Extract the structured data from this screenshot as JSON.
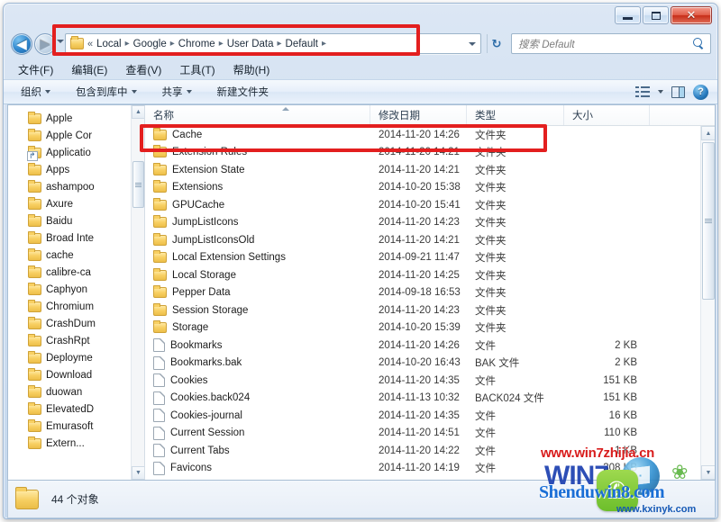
{
  "window": {
    "controls": {
      "minimize": "—",
      "maximize": "□",
      "close": "✕"
    }
  },
  "navigation": {
    "back_icon": "◀",
    "forward_icon": "▶",
    "history_dropdown_icon": "chevron-down",
    "breadcrumb_prefix": "«",
    "breadcrumb": [
      "Local",
      "Google",
      "Chrome",
      "User Data",
      "Default"
    ],
    "separator": "▸",
    "refresh_icon": "↻"
  },
  "search": {
    "placeholder": "搜索 Default",
    "icon": "search-icon"
  },
  "menubar": {
    "items": [
      {
        "label": "文件(F)"
      },
      {
        "label": "编辑(E)"
      },
      {
        "label": "查看(V)"
      },
      {
        "label": "工具(T)"
      },
      {
        "label": "帮助(H)"
      }
    ]
  },
  "toolbar": {
    "organize": "组织",
    "include_library": "包含到库中",
    "share": "共享",
    "new_folder": "新建文件夹",
    "views_icon": "views-icon",
    "preview_pane_icon": "preview-pane-icon",
    "help_icon": "?"
  },
  "nav_pane": {
    "items": [
      {
        "label": "Apple",
        "icon": "folder"
      },
      {
        "label": "Apple Cor",
        "icon": "folder"
      },
      {
        "label": "Applicatio",
        "icon": "shortcut-folder"
      },
      {
        "label": "Apps",
        "icon": "folder"
      },
      {
        "label": "ashampoo",
        "icon": "folder"
      },
      {
        "label": "Axure",
        "icon": "folder"
      },
      {
        "label": "Baidu",
        "icon": "folder"
      },
      {
        "label": "Broad Inte",
        "icon": "folder"
      },
      {
        "label": "cache",
        "icon": "folder"
      },
      {
        "label": "calibre-ca",
        "icon": "folder"
      },
      {
        "label": "Caphyon",
        "icon": "folder"
      },
      {
        "label": "Chromium",
        "icon": "folder"
      },
      {
        "label": "CrashDum",
        "icon": "folder"
      },
      {
        "label": "CrashRpt",
        "icon": "folder"
      },
      {
        "label": "Deployme",
        "icon": "folder"
      },
      {
        "label": "Download",
        "icon": "folder"
      },
      {
        "label": "duowan",
        "icon": "folder"
      },
      {
        "label": "ElevatedD",
        "icon": "folder"
      },
      {
        "label": "Emurasoft",
        "icon": "folder"
      },
      {
        "label": "Extern...",
        "icon": "folder"
      }
    ]
  },
  "file_list": {
    "columns": {
      "name": "名称",
      "date": "修改日期",
      "type": "类型",
      "size": "大小"
    },
    "rows": [
      {
        "name": "Cache",
        "date": "2014-11-20 14:26",
        "type": "文件夹",
        "size": "",
        "icon": "folder"
      },
      {
        "name": "Extension Rules",
        "date": "2014-11-20 14:21",
        "type": "文件夹",
        "size": "",
        "icon": "folder"
      },
      {
        "name": "Extension State",
        "date": "2014-11-20 14:21",
        "type": "文件夹",
        "size": "",
        "icon": "folder"
      },
      {
        "name": "Extensions",
        "date": "2014-10-20 15:38",
        "type": "文件夹",
        "size": "",
        "icon": "folder"
      },
      {
        "name": "GPUCache",
        "date": "2014-10-20 15:41",
        "type": "文件夹",
        "size": "",
        "icon": "folder"
      },
      {
        "name": "JumpListIcons",
        "date": "2014-11-20 14:23",
        "type": "文件夹",
        "size": "",
        "icon": "folder"
      },
      {
        "name": "JumpListIconsOld",
        "date": "2014-11-20 14:21",
        "type": "文件夹",
        "size": "",
        "icon": "folder"
      },
      {
        "name": "Local Extension Settings",
        "date": "2014-09-21 11:47",
        "type": "文件夹",
        "size": "",
        "icon": "folder"
      },
      {
        "name": "Local Storage",
        "date": "2014-11-20 14:25",
        "type": "文件夹",
        "size": "",
        "icon": "folder"
      },
      {
        "name": "Pepper Data",
        "date": "2014-09-18 16:53",
        "type": "文件夹",
        "size": "",
        "icon": "folder"
      },
      {
        "name": "Session Storage",
        "date": "2014-11-20 14:23",
        "type": "文件夹",
        "size": "",
        "icon": "folder"
      },
      {
        "name": "Storage",
        "date": "2014-10-20 15:39",
        "type": "文件夹",
        "size": "",
        "icon": "folder"
      },
      {
        "name": "Bookmarks",
        "date": "2014-11-20 14:26",
        "type": "文件",
        "size": "2 KB",
        "icon": "file"
      },
      {
        "name": "Bookmarks.bak",
        "date": "2014-10-20 16:43",
        "type": "BAK 文件",
        "size": "2 KB",
        "icon": "file"
      },
      {
        "name": "Cookies",
        "date": "2014-11-20 14:35",
        "type": "文件",
        "size": "151 KB",
        "icon": "file"
      },
      {
        "name": "Cookies.back024",
        "date": "2014-11-13 10:32",
        "type": "BACK024 文件",
        "size": "151 KB",
        "icon": "file"
      },
      {
        "name": "Cookies-journal",
        "date": "2014-11-20 14:35",
        "type": "文件",
        "size": "16 KB",
        "icon": "file"
      },
      {
        "name": "Current Session",
        "date": "2014-11-20 14:51",
        "type": "文件",
        "size": "110 KB",
        "icon": "file"
      },
      {
        "name": "Current Tabs",
        "date": "2014-11-20 14:22",
        "type": "文件",
        "size": "1 KB",
        "icon": "file"
      },
      {
        "name": "Favicons",
        "date": "2014-11-20 14:19",
        "type": "文件",
        "size": "308 KB",
        "icon": "file"
      }
    ]
  },
  "status_bar": {
    "text": "44 个对象",
    "icon": "folder-icon"
  },
  "annotations": {
    "address_box_color": "#e31f1f",
    "cache_box_color": "#e31f1f"
  },
  "watermarks": {
    "win7zhijia": "www.win7zhijia.cn",
    "win7jia": "WIN7",
    "shenduwin8": "Shenduwin8.com",
    "kxinyk": "www.kxinyk.com",
    "leaves_glyph": "❀"
  }
}
